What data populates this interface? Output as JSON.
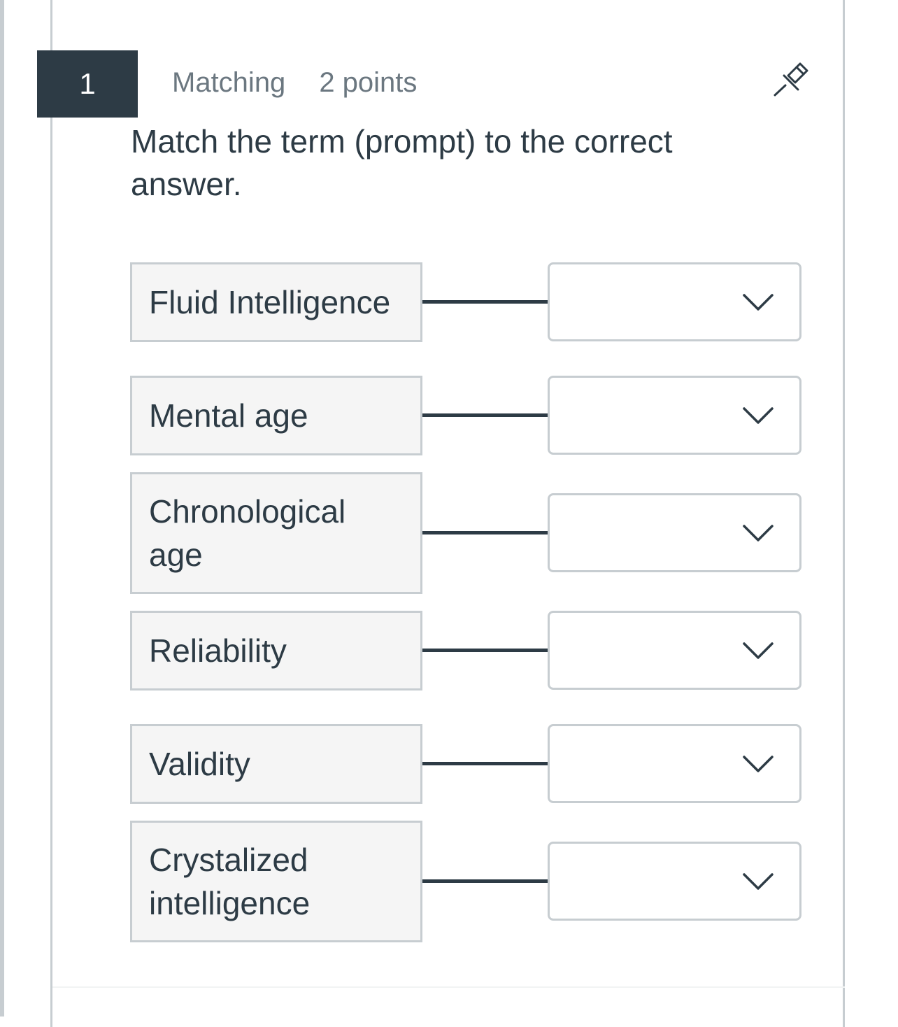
{
  "question": {
    "number": "1",
    "type": "Matching",
    "points": "2 points",
    "prompt": "Match the term (prompt) to the correct answer."
  },
  "icons": {
    "pin": "pin-icon",
    "dropdown": "chevron-down-icon"
  },
  "colors": {
    "badge_bg": "#2d3b45",
    "text": "#2d3b45",
    "meta_text": "#6b7780",
    "border": "#c7cdd1",
    "term_bg": "#f5f5f5"
  },
  "matches": [
    {
      "term": "Fluid Intelligence",
      "selected": ""
    },
    {
      "term": "Mental age",
      "selected": ""
    },
    {
      "term": "Chronological age",
      "selected": ""
    },
    {
      "term": "Reliability",
      "selected": ""
    },
    {
      "term": "Validity",
      "selected": ""
    },
    {
      "term": "Crystalized intelligence",
      "selected": ""
    }
  ]
}
